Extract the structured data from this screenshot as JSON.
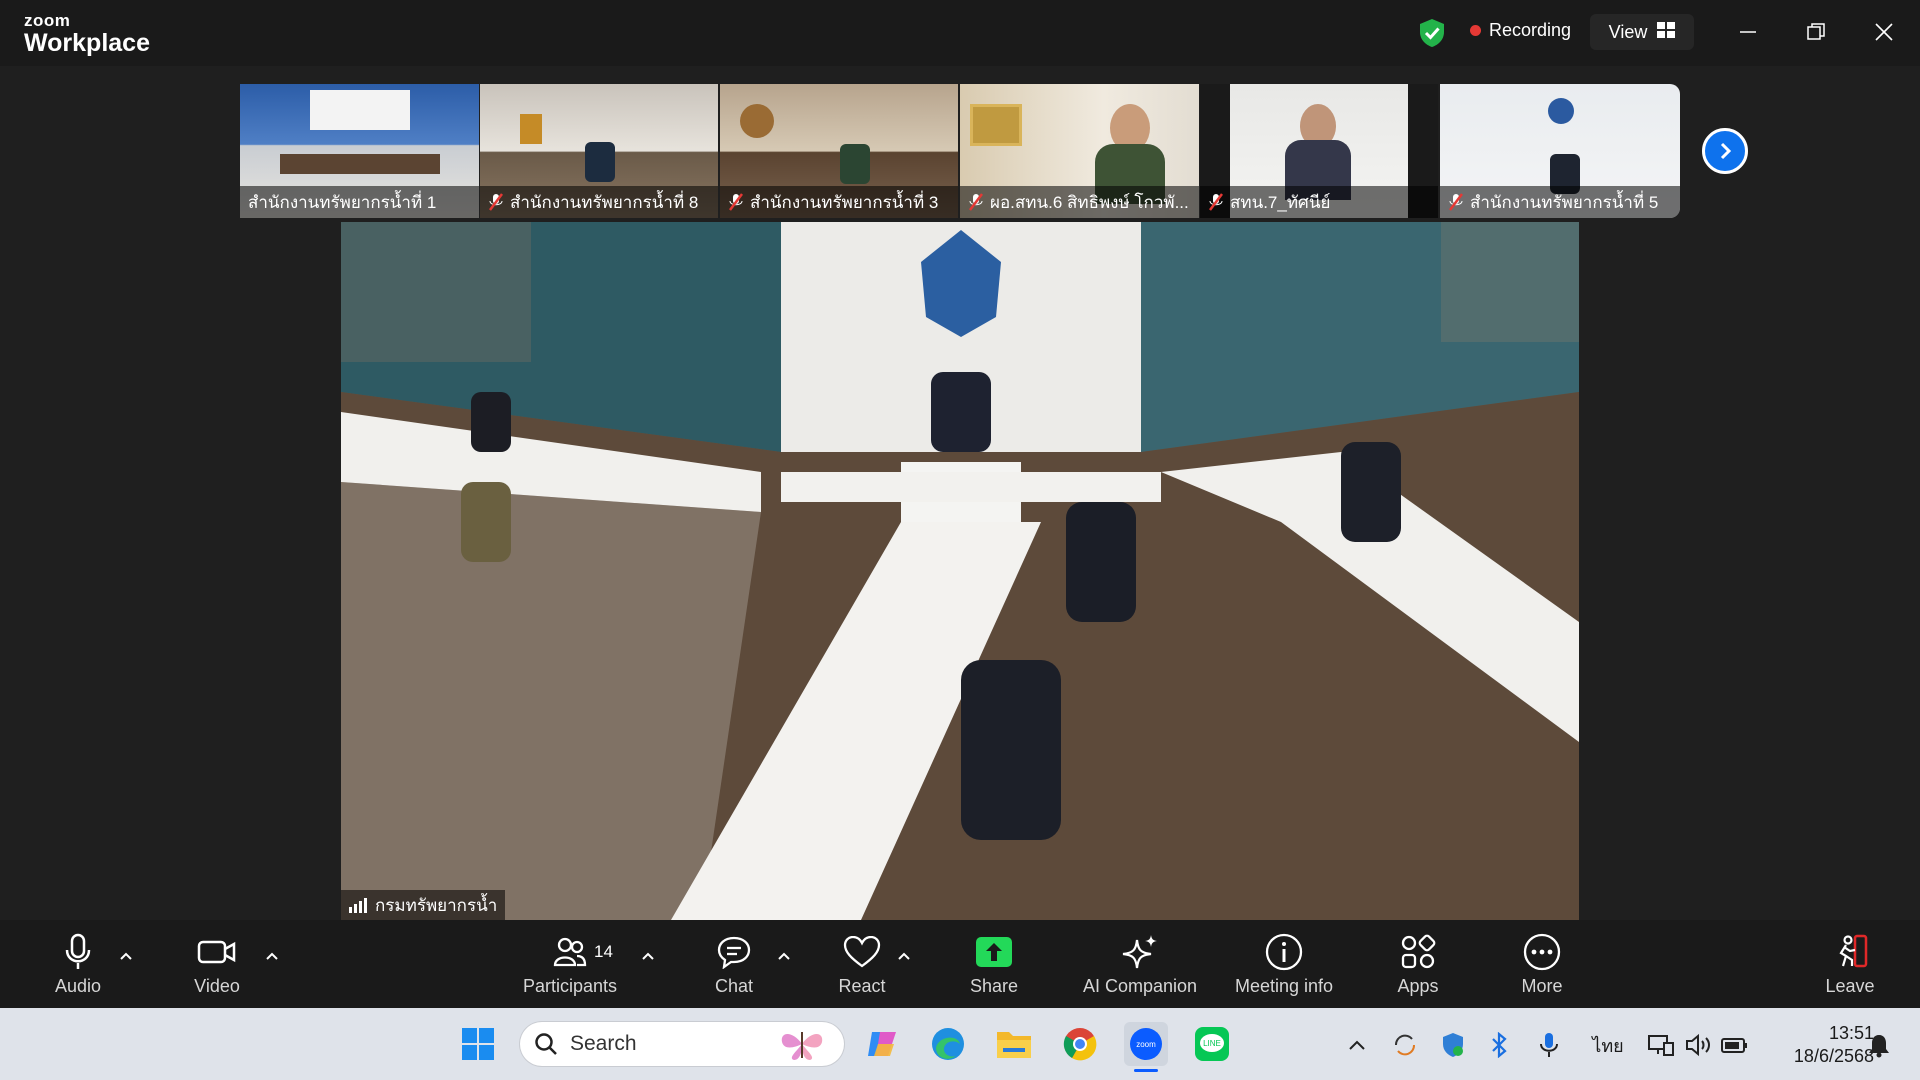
{
  "app": {
    "brand_top": "zoom",
    "brand_bottom": "Workplace"
  },
  "titlebar": {
    "recording": "Recording",
    "view": "View"
  },
  "thumbnails": [
    {
      "label": "สำนักงานทรัพยากรน้ำที่ 1",
      "muted": false
    },
    {
      "label": "สำนักงานทรัพยากรน้ำที่ 8",
      "muted": true
    },
    {
      "label": "สำนักงานทรัพยากรน้ำที่ 3",
      "muted": true
    },
    {
      "label": "ผอ.สทน.6 สิทธิพงษ์ โกวพั...",
      "muted": true
    },
    {
      "label": "สทน.7_ทัศนีย์",
      "muted": true
    },
    {
      "label": "สำนักงานทรัพยากรน้ำที่ 5",
      "muted": true
    }
  ],
  "main_video": {
    "name": "กรมทรัพยากรน้ำ"
  },
  "toolbar": {
    "audio": "Audio",
    "video": "Video",
    "participants": "Participants",
    "participants_count": "14",
    "chat": "Chat",
    "react": "React",
    "share": "Share",
    "ai_companion": "AI Companion",
    "meeting_info": "Meeting info",
    "apps": "Apps",
    "more": "More",
    "leave": "Leave"
  },
  "taskbar": {
    "search_placeholder": "Search",
    "language": "ไทย",
    "time": "13:51",
    "date": "18/6/2568"
  },
  "colors": {
    "share_green": "#23d959",
    "accent_blue": "#0e72ed",
    "leave_red": "#e02828"
  }
}
